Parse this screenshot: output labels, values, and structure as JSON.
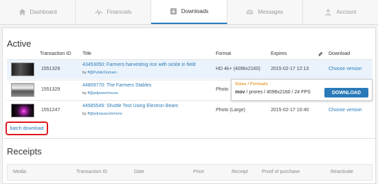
{
  "nav": {
    "tabs": [
      {
        "label": "Dashboard",
        "icon": "home-icon"
      },
      {
        "label": "Financials",
        "icon": "pulse-icon"
      },
      {
        "label": "Downloads",
        "icon": "download-icon",
        "active": true
      },
      {
        "label": "Messages",
        "icon": "envelope-icon"
      },
      {
        "label": "Account",
        "icon": "user-icon"
      }
    ]
  },
  "active": {
    "title": "Active",
    "columns": {
      "transaction_id": "Transaction ID",
      "title": "Title",
      "format": "Format",
      "expires": "Expires",
      "download": "Download"
    },
    "rows": [
      {
        "transaction_id": "1551329",
        "title": "43453050: Farmers harvesting rice with sickle in field",
        "by_prefix": "by ",
        "by_user": "ff@PublicDomain",
        "format": "HD 4k+ (4096x2160)",
        "expires": "2015-02-17 12:13",
        "action": "Choose version"
      },
      {
        "transaction_id": "1551329",
        "title": "44809770: The Farmers Stables",
        "by_prefix": "by ",
        "by_user": "ff@pdpowerhouse",
        "format": "Photo",
        "expires": "",
        "action": ""
      },
      {
        "transaction_id": "1551247",
        "title": "44585549: Shuttle Test Using Electron Beam",
        "by_prefix": "by ",
        "by_user": "ff@pdnasacommons",
        "format": "Photo (Large)",
        "expires": "2015-02-17 10:40",
        "action": "Choose version"
      }
    ],
    "popup": {
      "heading": "Sizes / Formats",
      "format_bold": "mov",
      "format_rest": " / prores / 4096x2160 / 24 FPS",
      "button": "DOWNLOAD"
    },
    "batch_download": "batch download"
  },
  "receipts": {
    "title": "Receipts",
    "columns": [
      "Media",
      "Transaction ID",
      "Date",
      "Price",
      "Receipt",
      "Proof of purchase",
      "Reactivate"
    ]
  },
  "colors": {
    "accent": "#2a7ab8",
    "highlight_row": "#eaf3fb",
    "popup_heading": "#e8a03a",
    "batch_border": "#e0141e"
  }
}
